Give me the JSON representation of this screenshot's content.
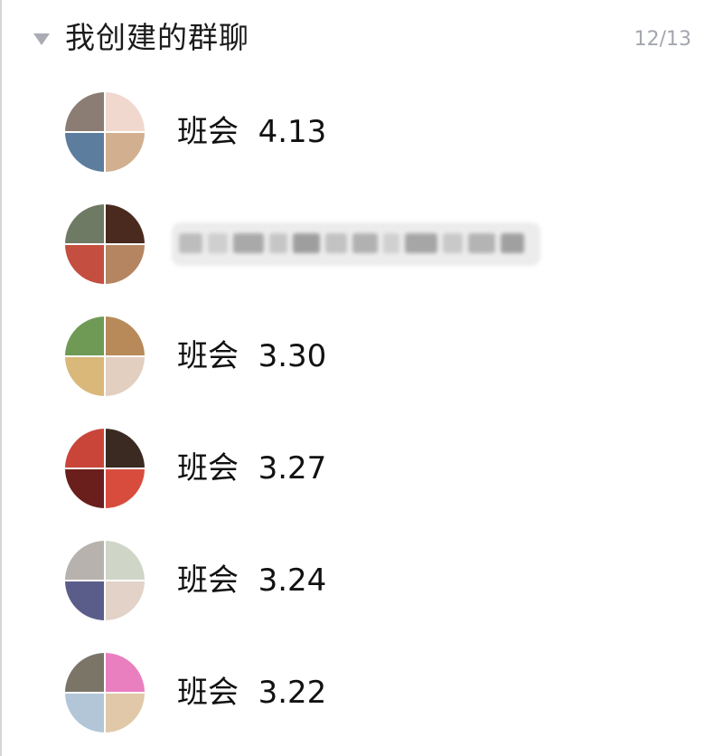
{
  "group": {
    "title": "我创建的群聊",
    "count": "12/13",
    "caret_icon": "caret-down-icon"
  },
  "chats": [
    {
      "name": "班会  4.13",
      "avatar_colors": [
        "#8c7d74",
        "#f1d8cf",
        "#5d7d9e",
        "#d2b08f"
      ]
    },
    {
      "name": "",
      "redacted": true,
      "avatar_colors": [
        "#6f7a65",
        "#4a2a1f",
        "#c44e3f",
        "#b58561"
      ]
    },
    {
      "name": "班会  3.30",
      "avatar_colors": [
        "#6f9a55",
        "#b88a5a",
        "#d9b87a",
        "#e2cfc0"
      ]
    },
    {
      "name": "班会  3.27",
      "avatar_colors": [
        "#c9453a",
        "#3a2a22",
        "#6a1f1c",
        "#d84c3e"
      ]
    },
    {
      "name": "班会  3.24",
      "avatar_colors": [
        "#b7b2ad",
        "#cfd6c8",
        "#5a5d8a",
        "#e3d2c8"
      ]
    },
    {
      "name": "班会  3.22",
      "avatar_colors": [
        "#7b7568",
        "#e97fbf",
        "#b2c6d8",
        "#e0c8a8"
      ]
    }
  ]
}
